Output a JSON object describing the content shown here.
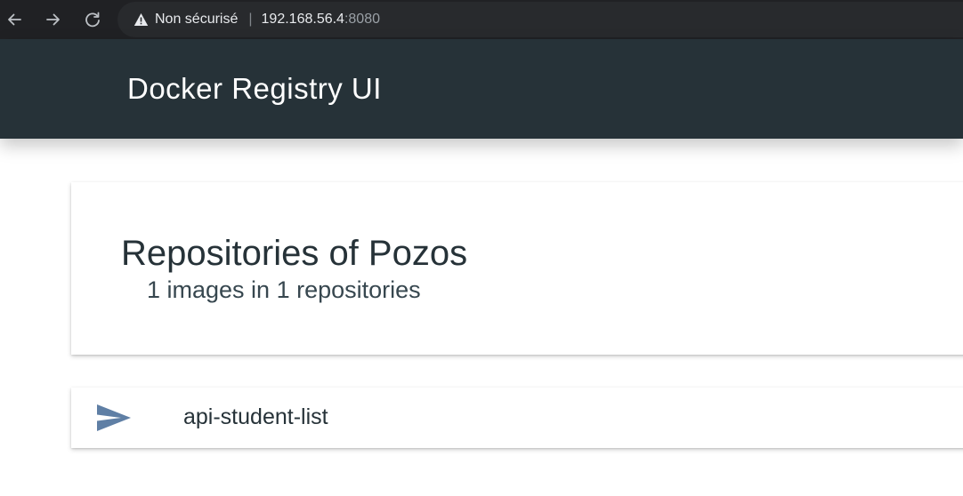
{
  "browser": {
    "security_label": "Non sécurisé",
    "separator": "|",
    "url_host": "192.168.56.4",
    "url_port": ":8080",
    "icons": {
      "back": "arrow-back-icon",
      "forward": "arrow-forward-icon",
      "reload": "reload-icon",
      "warning": "warning-triangle-icon"
    }
  },
  "header": {
    "title": "Docker Registry UI"
  },
  "overview": {
    "title": "Repositories of Pozos",
    "subtitle": "1 images in 1 repositories"
  },
  "repositories": [
    {
      "name": "api-student-list",
      "icon": "send-arrow-icon"
    }
  ],
  "colors": {
    "browser_bg": "#202124",
    "header_bg": "#263238",
    "repo_icon": "#5f7fa5"
  }
}
